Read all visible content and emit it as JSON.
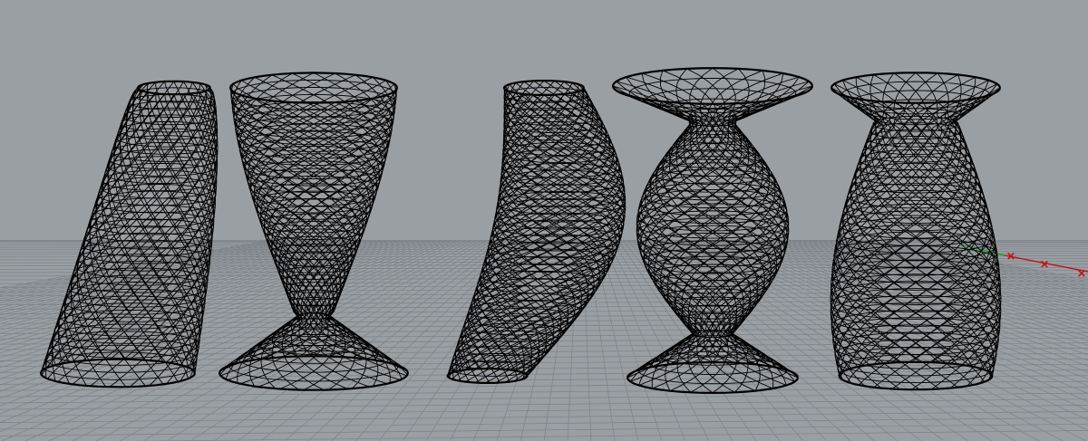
{
  "viewport": {
    "kind": "3D perspective viewport, wireframe display mode",
    "background_color": "#9a9fa4",
    "grid_color": "#7c8186",
    "wire_color": "#000000",
    "axis_colors": {
      "x": "#c01010",
      "y": "#12a012"
    },
    "point_marker_color": "#c01010"
  },
  "objects": [
    {
      "name": "bent-lofted-vase",
      "shape": "curved-twisted-slab"
    },
    {
      "name": "twisted-goblet-vase",
      "shape": "goblet-on-twisted-square-base"
    },
    {
      "name": "twisted-column-vase",
      "shape": "s-bent-column"
    },
    {
      "name": "bulb-vase",
      "shape": "bulb-on-twisted-square-base"
    },
    {
      "name": "flared-vase",
      "shape": "flared-neck-vase"
    }
  ],
  "point_markers": {
    "count": 3,
    "glyph": "×"
  }
}
